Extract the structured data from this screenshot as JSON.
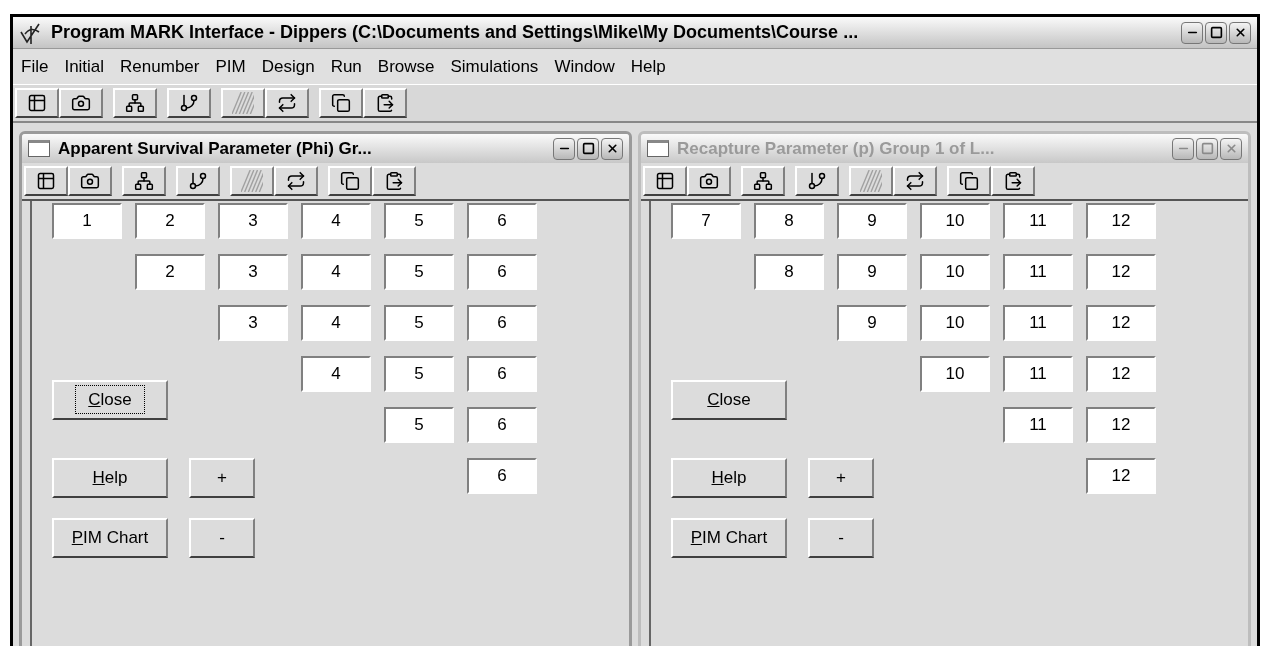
{
  "window": {
    "title": "Program MARK Interface - Dippers  (C:\\Documents and Settings\\Mike\\My Documents\\Course ..."
  },
  "menu": [
    "File",
    "Initial",
    "Renumber",
    "PIM",
    "Design",
    "Run",
    "Browse",
    "Simulations",
    "Window",
    "Help"
  ],
  "toolbar": [
    [
      {
        "kind": "table",
        "disabled": false
      },
      {
        "kind": "camera",
        "disabled": false
      }
    ],
    [
      {
        "kind": "tree",
        "disabled": false
      }
    ],
    [
      {
        "kind": "branch",
        "disabled": false
      }
    ],
    [
      {
        "kind": "hatch",
        "disabled": true
      },
      {
        "kind": "loop",
        "disabled": false
      }
    ],
    [
      {
        "kind": "copy",
        "disabled": false
      },
      {
        "kind": "paste",
        "disabled": false
      }
    ]
  ],
  "child_windows": [
    {
      "title": "Apparent Survival Parameter (Phi) Gr...",
      "active": true,
      "rows": [
        [
          "1",
          "2",
          "3",
          "4",
          "5",
          "6"
        ],
        [
          "",
          "2",
          "3",
          "4",
          "5",
          "6"
        ],
        [
          "",
          "",
          "3",
          "4",
          "5",
          "6"
        ],
        [
          "",
          "",
          "",
          "4",
          "5",
          "6"
        ],
        [
          "",
          "",
          "",
          "",
          "5",
          "6"
        ],
        [
          "",
          "",
          "",
          "",
          "",
          "6"
        ]
      ],
      "close": {
        "label": "Close",
        "focused": true
      },
      "help": {
        "label": "Help"
      },
      "plus": "+",
      "chart": {
        "label": "PIM Chart"
      },
      "minus": "-"
    },
    {
      "title": "Recapture Parameter (p) Group 1 of L...",
      "active": false,
      "rows": [
        [
          "7",
          "8",
          "9",
          "10",
          "11",
          "12"
        ],
        [
          "",
          "8",
          "9",
          "10",
          "11",
          "12"
        ],
        [
          "",
          "",
          "9",
          "10",
          "11",
          "12"
        ],
        [
          "",
          "",
          "",
          "10",
          "11",
          "12"
        ],
        [
          "",
          "",
          "",
          "",
          "11",
          "12"
        ],
        [
          "",
          "",
          "",
          "",
          "",
          "12"
        ]
      ],
      "close": {
        "label": "Close",
        "focused": false
      },
      "help": {
        "label": "Help"
      },
      "plus": "+",
      "chart": {
        "label": "PIM Chart"
      },
      "minus": "-"
    }
  ]
}
